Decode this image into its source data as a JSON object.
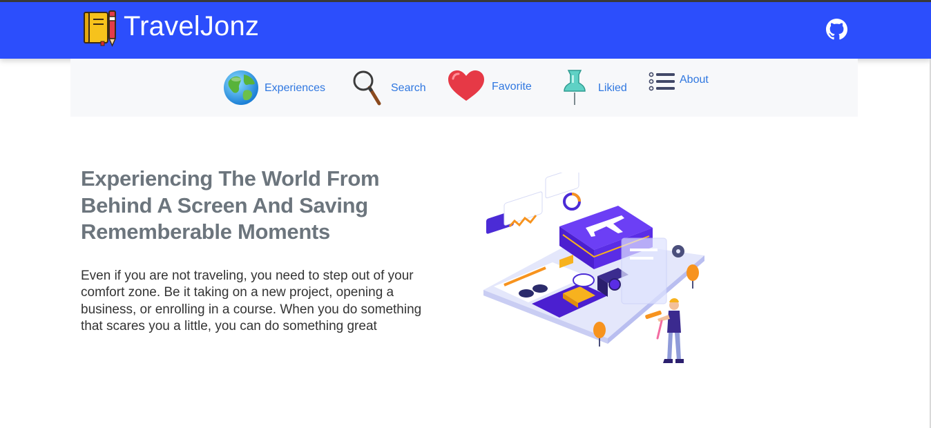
{
  "header": {
    "brand_name": "TravelJonz",
    "brand_icon": "notebook-pen-icon",
    "github_icon": "github-icon",
    "accent_color": "#2c4efc"
  },
  "nav": {
    "items": [
      {
        "label": "Experiences",
        "icon": "globe-icon"
      },
      {
        "label": "Search",
        "icon": "magnifier-icon"
      },
      {
        "label": "Favorite",
        "icon": "heart-icon"
      },
      {
        "label": "Likied",
        "icon": "pushpin-icon"
      },
      {
        "label": "About",
        "icon": "list-icon"
      }
    ],
    "link_color": "#2f77e0"
  },
  "hero": {
    "headline": "Experiencing The World From Behind A Screen And Saving Rememberable Moments",
    "body": "Even if you are not traveling, you need to step out of your comfort zone. Be it taking on a new project, opening a business, or enrolling in a course. When you do something that scares you a little, you can do something great",
    "illustration": "isometric-travel-illustration"
  }
}
